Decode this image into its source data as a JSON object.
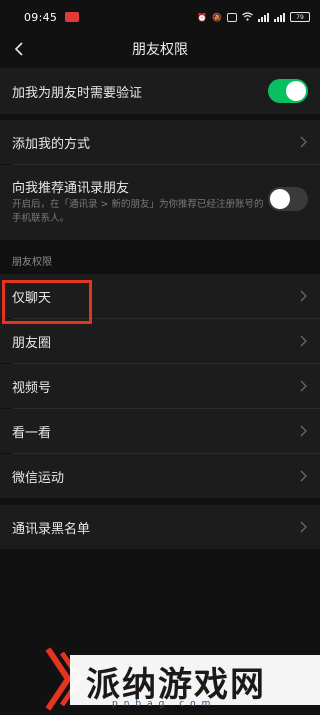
{
  "status_bar": {
    "time": "09:45",
    "battery": "79"
  },
  "nav": {
    "title": "朋友权限"
  },
  "rows": {
    "verify": {
      "label": "加我为朋友时需要验证",
      "toggle": "on"
    },
    "add_methods": {
      "label": "添加我的方式"
    },
    "recommend": {
      "label": "向我推荐通讯录朋友",
      "desc": "开启后，在「通讯录 > 新的朋友」为你推荐已经注册账号的手机联系人。",
      "toggle": "off"
    }
  },
  "section": {
    "header": "朋友权限",
    "items": [
      "仅聊天",
      "朋友圈",
      "视频号",
      "看一看",
      "微信运动"
    ]
  },
  "blacklist": {
    "label": "通讯录黑名单"
  },
  "watermark": {
    "text": "派纳游戏网",
    "domain": "pnbag.com"
  },
  "colors": {
    "toggle_on": "#07c160",
    "highlight": "#e2341f",
    "background": "#111111"
  }
}
